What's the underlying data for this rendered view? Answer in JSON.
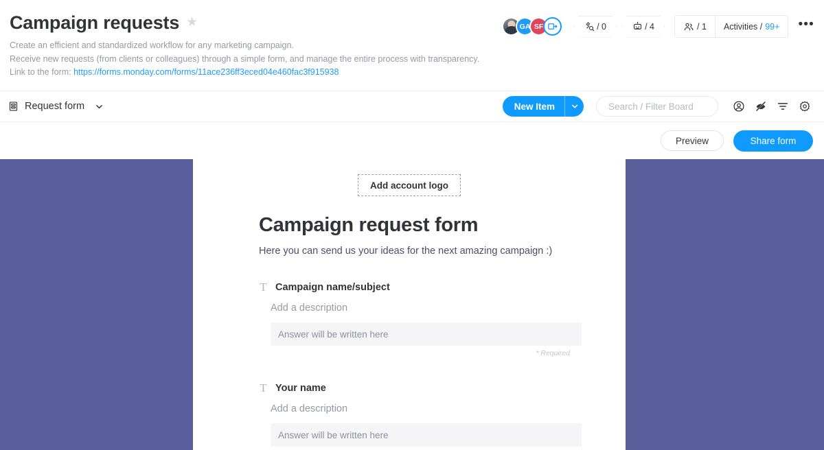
{
  "board": {
    "title": "Campaign requests",
    "star_icon": "star-icon",
    "description_lines": [
      "Create an efficient and standardized workflow for any marketing campaign.",
      "Receive new requests (from clients or colleagues) through a simple form, and manage the entire process with transparency."
    ],
    "link_prefix": "Link to the form: ",
    "link_text": "https://forms.monday.com/forms/11ace236ff3eced04e460fac3f915938"
  },
  "header_right": {
    "avatars": [
      {
        "type": "photo",
        "initials": "",
        "color": "#5d6b78",
        "name": "avatar-user-photo"
      },
      {
        "type": "initials",
        "initials": "GA",
        "color": "#1f9bfe",
        "name": "avatar-ga"
      },
      {
        "type": "initials",
        "initials": "SF",
        "color": "#e2445c",
        "name": "avatar-sf"
      },
      {
        "type": "more",
        "initials": "",
        "color": "#0f9bfe",
        "name": "avatar-invite-more"
      }
    ],
    "badges": [
      {
        "icon": "integrations-icon",
        "value": "/ 0"
      },
      {
        "icon": "automations-robot-icon",
        "value": "/ 4"
      }
    ],
    "pills": [
      {
        "icon": "people-icon",
        "label": "",
        "value": "/ 1"
      },
      {
        "icon": "",
        "label": "Activities /",
        "value": "99+"
      }
    ],
    "more_menu": "•••"
  },
  "toolbar": {
    "view_icon": "board-view-icon",
    "view_label": "Request form",
    "view_chevron": "chevron-down-icon",
    "new_item_label": "New Item",
    "new_item_chevron": "chevron-down-icon",
    "search_placeholder": "Search / Filter Board",
    "icons": [
      {
        "name": "person-filter-icon"
      },
      {
        "name": "hide-eye-slash-icon"
      },
      {
        "name": "filter-icon"
      },
      {
        "name": "settings-gear-icon"
      }
    ]
  },
  "action_bar": {
    "preview_label": "Preview",
    "share_label": "Share form"
  },
  "form": {
    "logo_placeholder": "Add account logo",
    "title": "Campaign request form",
    "description": "Here you can send us your ideas for the next amazing campaign :)",
    "fields": [
      {
        "type_icon": "T",
        "label": "Campaign name/subject",
        "description_placeholder": "Add a description",
        "answer_placeholder": "Answer will be written here",
        "required_note": "* Required"
      },
      {
        "type_icon": "T",
        "label": "Your name",
        "description_placeholder": "Add a description",
        "answer_placeholder": "Answer will be written here",
        "required_note": ""
      }
    ]
  },
  "colors": {
    "accent_blue": "#0f9bfe",
    "link_blue": "#1f9bfe",
    "canvas_purple": "#585f9b",
    "text_dark": "#323338",
    "text_muted": "#9699a6"
  }
}
